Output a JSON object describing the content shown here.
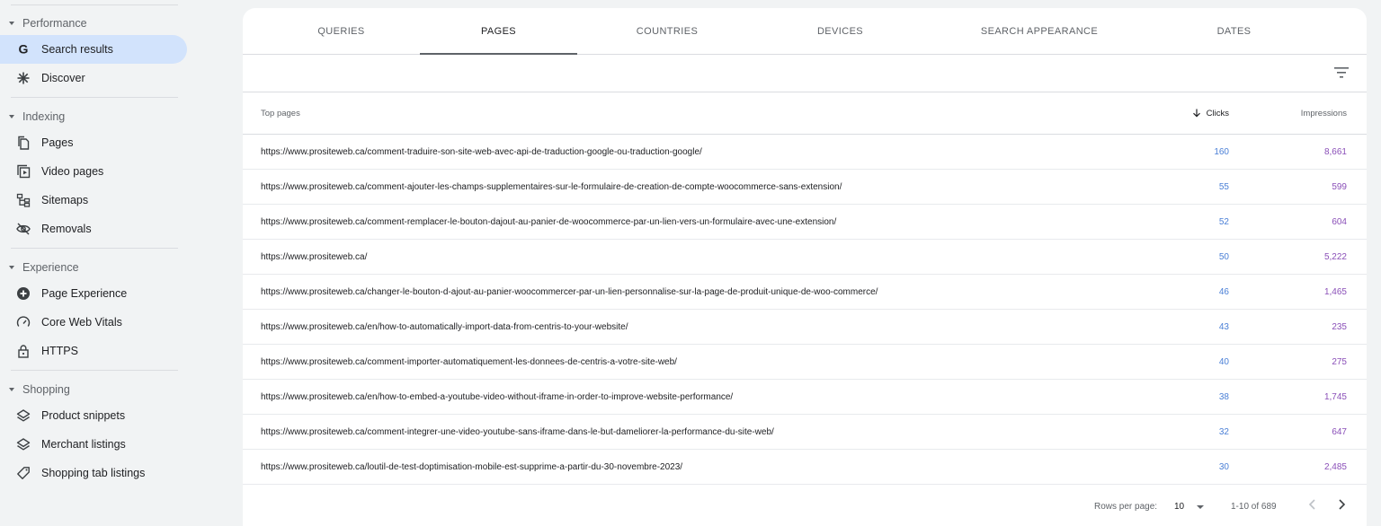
{
  "sidebar": {
    "sections": [
      {
        "title": "Performance",
        "items": [
          {
            "label": "Search results",
            "icon": "google-g-icon",
            "active": true
          },
          {
            "label": "Discover",
            "icon": "asterisk-icon"
          }
        ]
      },
      {
        "title": "Indexing",
        "items": [
          {
            "label": "Pages",
            "icon": "pages-icon"
          },
          {
            "label": "Video pages",
            "icon": "video-pages-icon"
          },
          {
            "label": "Sitemaps",
            "icon": "sitemap-icon"
          },
          {
            "label": "Removals",
            "icon": "eye-off-icon"
          }
        ]
      },
      {
        "title": "Experience",
        "items": [
          {
            "label": "Page Experience",
            "icon": "plus-circle-icon"
          },
          {
            "label": "Core Web Vitals",
            "icon": "gauge-icon"
          },
          {
            "label": "HTTPS",
            "icon": "lock-icon"
          }
        ]
      },
      {
        "title": "Shopping",
        "items": [
          {
            "label": "Product snippets",
            "icon": "layers-icon"
          },
          {
            "label": "Merchant listings",
            "icon": "layers-icon"
          },
          {
            "label": "Shopping tab listings",
            "icon": "tag-icon"
          }
        ]
      }
    ]
  },
  "tabs": [
    {
      "label": "QUERIES"
    },
    {
      "label": "PAGES",
      "active": true
    },
    {
      "label": "COUNTRIES"
    },
    {
      "label": "DEVICES"
    },
    {
      "label": "SEARCH APPEARANCE"
    },
    {
      "label": "DATES"
    }
  ],
  "table": {
    "col_page": "Top pages",
    "col_clicks": "Clicks",
    "col_impressions": "Impressions",
    "rows": [
      {
        "url": "https://www.prositeweb.ca/comment-traduire-son-site-web-avec-api-de-traduction-google-ou-traduction-google/",
        "clicks": "160",
        "impressions": "8,661"
      },
      {
        "url": "https://www.prositeweb.ca/comment-ajouter-les-champs-supplementaires-sur-le-formulaire-de-creation-de-compte-woocommerce-sans-extension/",
        "clicks": "55",
        "impressions": "599"
      },
      {
        "url": "https://www.prositeweb.ca/comment-remplacer-le-bouton-dajout-au-panier-de-woocommerce-par-un-lien-vers-un-formulaire-avec-une-extension/",
        "clicks": "52",
        "impressions": "604"
      },
      {
        "url": "https://www.prositeweb.ca/",
        "clicks": "50",
        "impressions": "5,222"
      },
      {
        "url": "https://www.prositeweb.ca/changer-le-bouton-d-ajout-au-panier-woocommercer-par-un-lien-personnalise-sur-la-page-de-produit-unique-de-woo-commerce/",
        "clicks": "46",
        "impressions": "1,465"
      },
      {
        "url": "https://www.prositeweb.ca/en/how-to-automatically-import-data-from-centris-to-your-website/",
        "clicks": "43",
        "impressions": "235"
      },
      {
        "url": "https://www.prositeweb.ca/comment-importer-automatiquement-les-donnees-de-centris-a-votre-site-web/",
        "clicks": "40",
        "impressions": "275"
      },
      {
        "url": "https://www.prositeweb.ca/en/how-to-embed-a-youtube-video-without-iframe-in-order-to-improve-website-performance/",
        "clicks": "38",
        "impressions": "1,745"
      },
      {
        "url": "https://www.prositeweb.ca/comment-integrer-une-video-youtube-sans-iframe-dans-le-but-dameliorer-la-performance-du-site-web/",
        "clicks": "32",
        "impressions": "647"
      },
      {
        "url": "https://www.prositeweb.ca/loutil-de-test-doptimisation-mobile-est-supprime-a-partir-du-30-novembre-2023/",
        "clicks": "30",
        "impressions": "2,485"
      }
    ]
  },
  "footer": {
    "rows_per_page_label": "Rows per page:",
    "rows_per_page_value": "10",
    "range": "1-10 of 689"
  },
  "colors": {
    "clicks": "#4a7fd6",
    "impressions": "#8a4fb8",
    "active_nav": "#d2e3fc"
  }
}
